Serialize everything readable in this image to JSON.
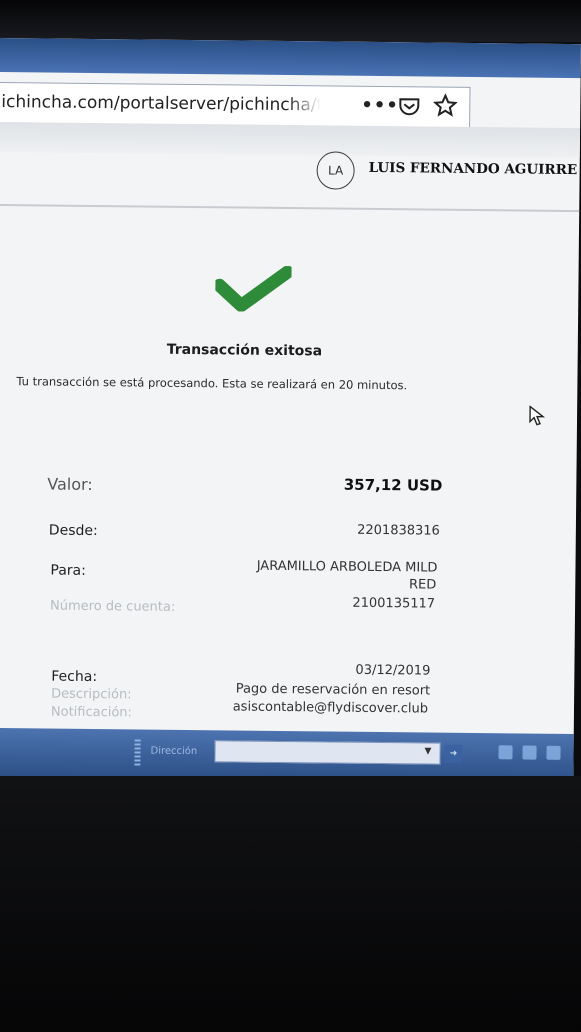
{
  "browser": {
    "url": "ichincha.com/portalserver/pichincha/trans",
    "more_label": "•••"
  },
  "header": {
    "avatar_initials": "LA",
    "user_name": "LUIS FERNANDO AGUIRRE A"
  },
  "status": {
    "title": "Transacción exitosa",
    "message": "Tu transacción se está procesando. Esta se realizará en 20 minutos.",
    "check_color": "#2e8b3a"
  },
  "details": {
    "valor_label": "Valor:",
    "valor_value": "357,12 USD",
    "desde_label": "Desde:",
    "desde_value": "2201838316",
    "para_label": "Para:",
    "para_value_line1": "JARAMILLO ARBOLEDA MILD",
    "para_value_line2": "RED",
    "cuenta_label": "Número de cuenta:",
    "cuenta_value": "2100135117",
    "fecha_label": "Fecha:",
    "fecha_value": "03/12/2019",
    "descripcion_label": "Descripción:",
    "descripcion_value": "Pago de reservación en resort",
    "notificacion_label": "Notificación:",
    "notificacion_value": "asiscontable@flydiscover.club"
  },
  "taskbar": {
    "address_label": "Dirección"
  }
}
